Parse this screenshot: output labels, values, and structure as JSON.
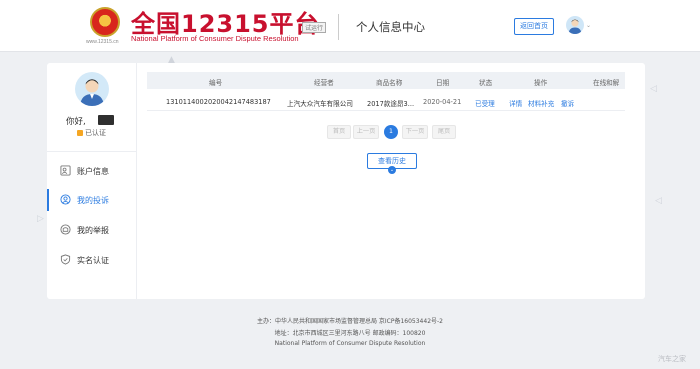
{
  "header": {
    "emblem_caption": "www.12315.cn",
    "brand_title": "全国12315平台",
    "brand_badge": "试运行",
    "brand_subtitle": "National Platform of Consumer Dispute Resolution",
    "section_title": "个人信息中心",
    "back_button": "返回首页",
    "avatar_icon": "user-avatar-icon"
  },
  "sidebar": {
    "greeting": "你好,",
    "verified": "已认证",
    "items": [
      {
        "label": "账户信息",
        "icon": "account-info-icon",
        "active": false
      },
      {
        "label": "我的投诉",
        "icon": "complaint-icon",
        "active": true
      },
      {
        "label": "我的举报",
        "icon": "report-icon",
        "active": false
      },
      {
        "label": "实名认证",
        "icon": "shield-icon",
        "active": false
      }
    ]
  },
  "table": {
    "headers": [
      "编号",
      "经营者",
      "商品名称",
      "日期",
      "状态",
      "操作",
      "在线和解"
    ],
    "rows": [
      {
        "id": "131011400202004214748318​7",
        "business": "上汽大众汽车有限公司",
        "product": "2017款途昂3...",
        "date": "2020-04-21",
        "status": "已受理",
        "actions": [
          "详情",
          "材料补充",
          "撤诉"
        ]
      }
    ]
  },
  "pagination": {
    "first": "首页",
    "prev": "上一页",
    "current": "1",
    "next": "下一页",
    "last": "尾页"
  },
  "history_button": "查看历史",
  "footer": {
    "line1": "主办：中华人民共和国国家市场监督管理总局 京ICP备16053442号-2",
    "line2": "地址：北京市西城区三里河东路八号 邮政编码：100820",
    "line3": "National Platform of Consumer Dispute Resolution"
  },
  "watermark": "汽车之家",
  "colors": {
    "accent": "#2b7be0",
    "brand_red": "#c8102e",
    "background": "#eef0f3"
  }
}
